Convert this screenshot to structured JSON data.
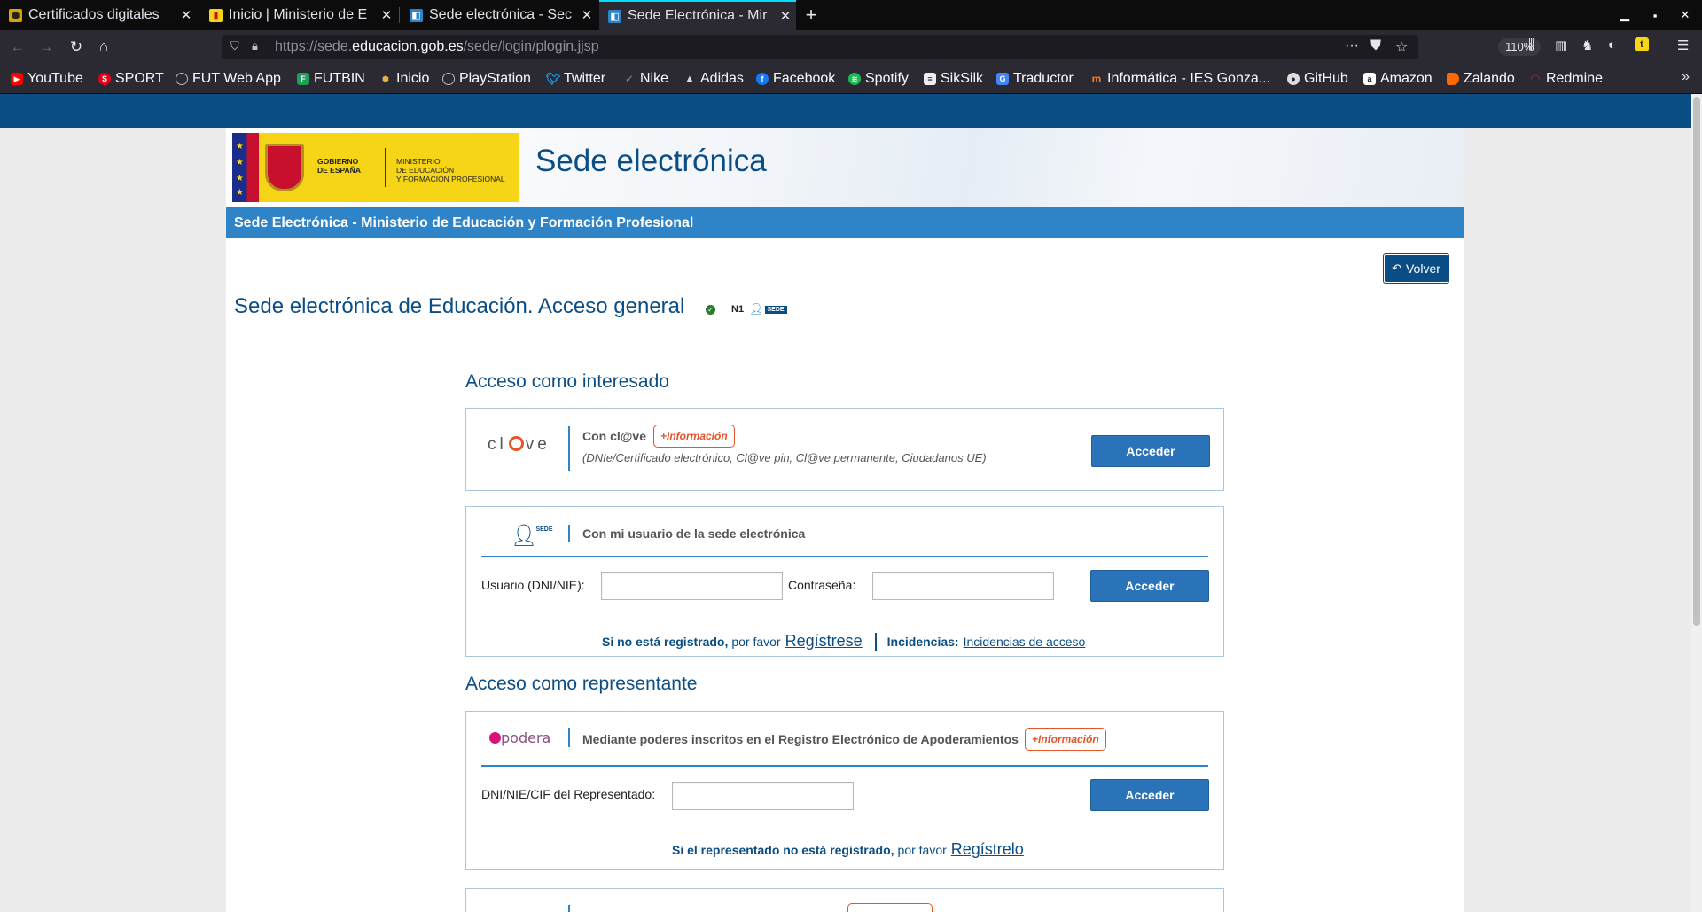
{
  "browser": {
    "tabs": [
      {
        "title": "Certificados digitales",
        "active": false
      },
      {
        "title": "Inicio | Ministerio de E",
        "active": false
      },
      {
        "title": "Sede electrónica - Sec",
        "active": false
      },
      {
        "title": "Sede Electrónica - Mir",
        "active": true
      }
    ],
    "url": {
      "prefix": "https://sede.",
      "host": "educacion.gob.es",
      "path": "/sede/login/plogin.jjsp"
    },
    "zoom": "110%",
    "bookmarks": [
      {
        "label": "YouTube",
        "icon": "youtube-icon",
        "color": "#ff0000"
      },
      {
        "label": "SPORT",
        "icon": "sport-icon",
        "color": "#e2001a"
      },
      {
        "label": "FUT Web App",
        "icon": "globe-icon",
        "color": "#5b5b66"
      },
      {
        "label": "FUTBIN",
        "icon": "futbin-icon",
        "color": "#1e9e5a"
      },
      {
        "label": "Inicio",
        "icon": "cube-icon",
        "color": "#6d5a2a"
      },
      {
        "label": "PlayStation",
        "icon": "globe-icon",
        "color": "#5b5b66"
      },
      {
        "label": "Twitter",
        "icon": "twitter-icon",
        "color": "#1d9bf0"
      },
      {
        "label": "Nike",
        "icon": "nike-icon",
        "color": "#2b2a33"
      },
      {
        "label": "Adidas",
        "icon": "adidas-icon",
        "color": "#2b2a33"
      },
      {
        "label": "Facebook",
        "icon": "facebook-icon",
        "color": "#1877f2"
      },
      {
        "label": "Spotify",
        "icon": "spotify-icon",
        "color": "#1db954"
      },
      {
        "label": "SikSilk",
        "icon": "siksilk-icon",
        "color": "#444"
      },
      {
        "label": "Traductor",
        "icon": "translate-icon",
        "color": "#4285f4"
      },
      {
        "label": "Informática - IES Gonza...",
        "icon": "moodle-icon",
        "color": "#f98012"
      },
      {
        "label": "GitHub",
        "icon": "github-icon",
        "color": "#444"
      },
      {
        "label": "Amazon",
        "icon": "amazon-icon",
        "color": "#222"
      },
      {
        "label": "Zalando",
        "icon": "zalando-icon",
        "color": "#ff6900"
      },
      {
        "label": "Redmine",
        "icon": "redmine-icon",
        "color": "#b32024"
      }
    ]
  },
  "header": {
    "logo_gov": "GOBIERNO\nDE ESPAÑA",
    "logo_min_1": "MINISTERIO",
    "logo_min_2": "DE EDUCACIÓN",
    "logo_min_3": "Y FORMACIÓN PROFESIONAL",
    "site_title": "Sede electrónica",
    "bar_text": "Sede Electrónica - Ministerio de Educación y Formación Profesional"
  },
  "main": {
    "volver_label": "Volver",
    "page_title": "Sede electrónica de Educación. Acceso general",
    "level_label": "N1",
    "sede_tag": "SEDE",
    "interesado": {
      "section_title": "Acceso como interesado",
      "clave": {
        "label": "Con cl@ve",
        "info_badge": "+Información",
        "sub": "(DNIe/Certificado electrónico, Cl@ve pin, Cl@ve permanente, Ciudadanos UE)",
        "button": "Acceder"
      },
      "sede_user": {
        "label": "Con mi usuario de la sede electrónica",
        "user_label": "Usuario (DNI/NIE):",
        "user_value": "",
        "password_label": "Contraseña:",
        "password_value": "",
        "button": "Acceder",
        "reg_bold": "Si no está registrado,",
        "reg_plain": "por favor",
        "reg_link": "Regístrese",
        "inc_label": "Incidencias:",
        "inc_link": "Incidencias de acceso"
      }
    },
    "representante": {
      "section_title": "Acceso como representante",
      "apodera": {
        "logo_text": "podera",
        "label": "Mediante poderes inscritos en el Registro Electrónico de Apoderamientos",
        "info_badge": "+Información",
        "field_label": "DNI/NIE/CIF del Representado:",
        "field_value": "",
        "button": "Acceder",
        "reg_bold": "Si el representado no está registrado,",
        "reg_plain": "por favor",
        "reg_link": "Regístrelo"
      }
    }
  },
  "colors": {
    "brand_blue": "#0b4d85",
    "bar_blue": "#2f84c7",
    "button_blue": "#2a73b8",
    "accent_orange": "#e4552a"
  }
}
